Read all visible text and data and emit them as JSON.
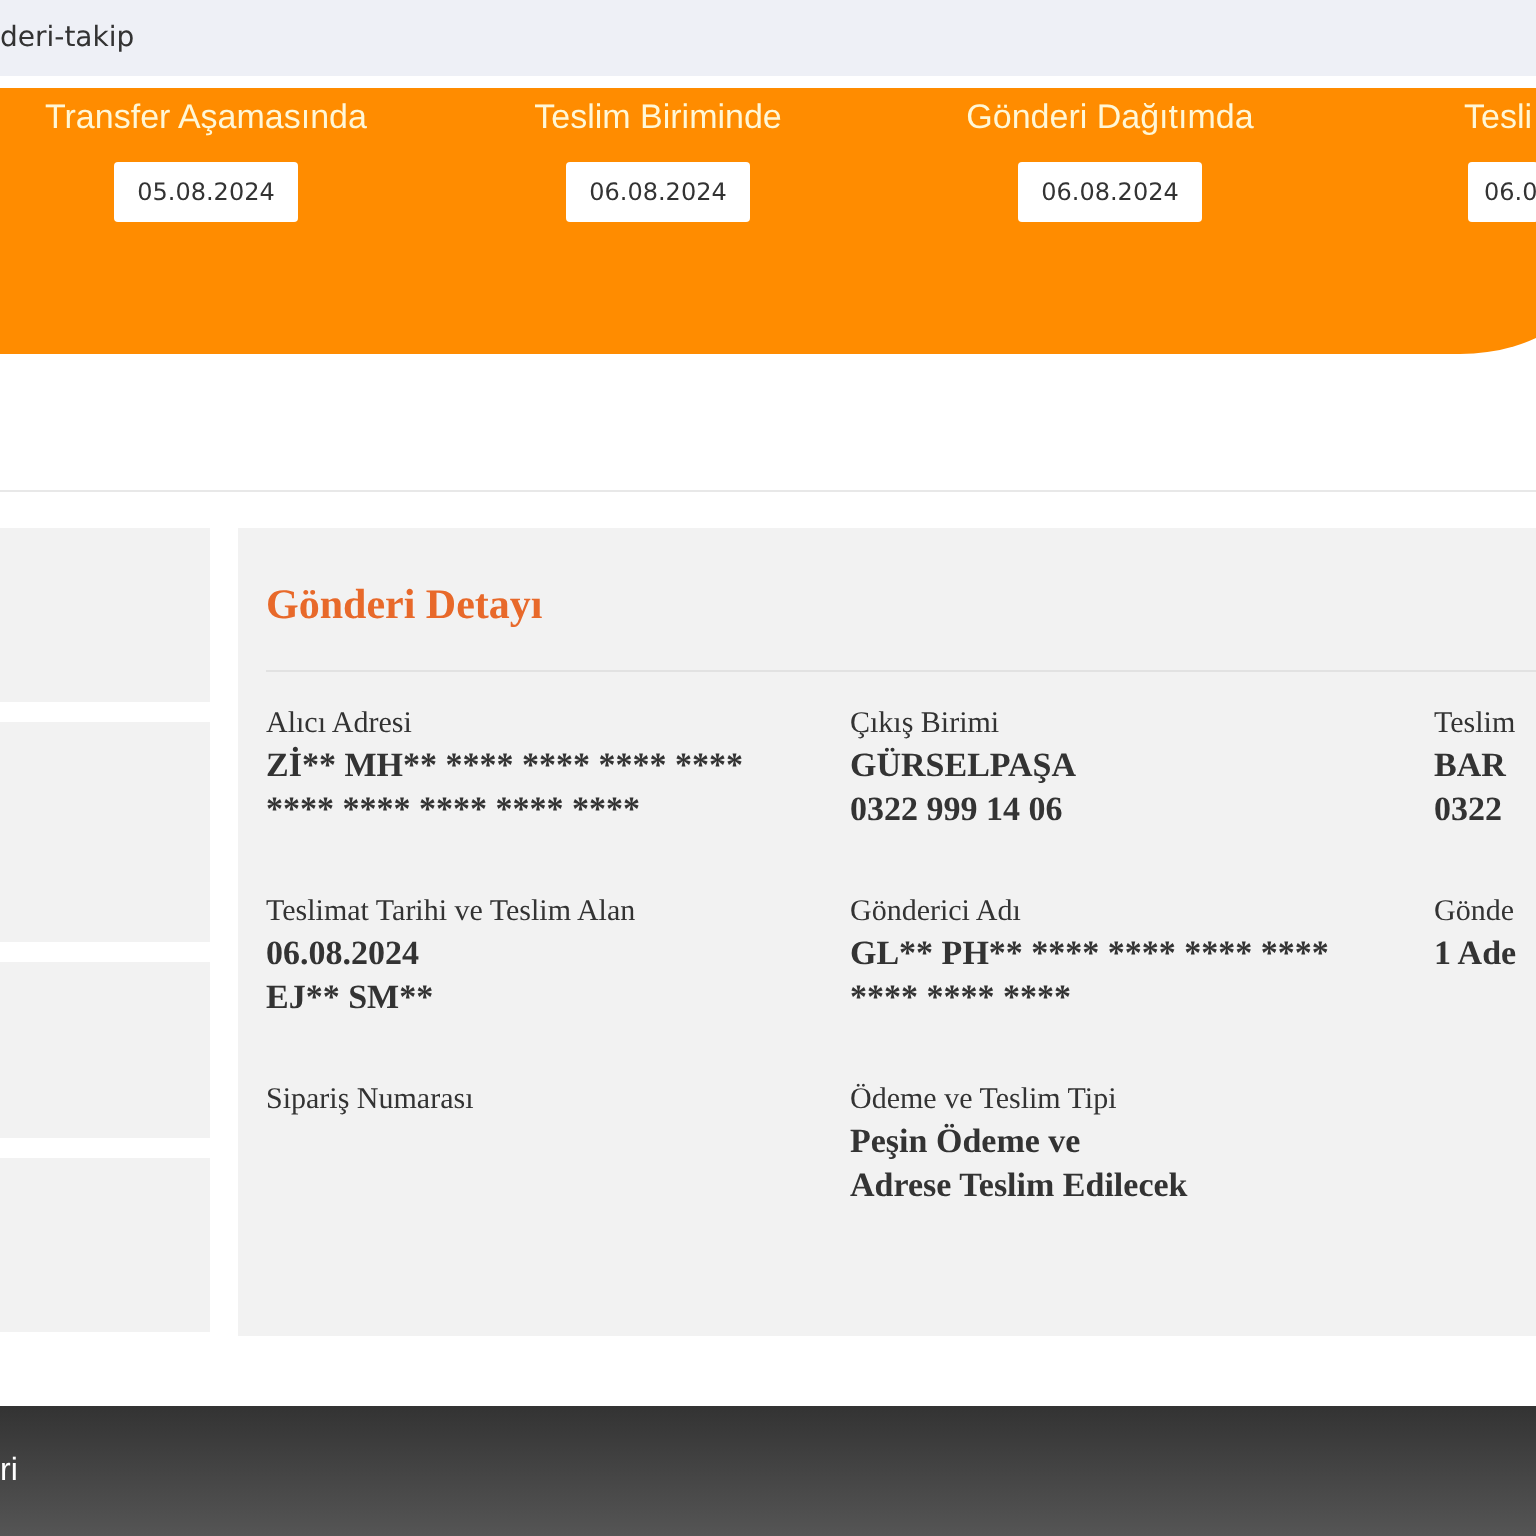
{
  "address_bar": {
    "text": "deri-takip"
  },
  "steps": [
    {
      "label": "Transfer Aşamasında",
      "date": "05.08.2024"
    },
    {
      "label": "Teslim Biriminde",
      "date": "06.08.2024"
    },
    {
      "label": "Gönderi Dağıtımda",
      "date": "06.08.2024"
    },
    {
      "label": "Tesli",
      "date": "06.0"
    }
  ],
  "detail": {
    "title": "Gönderi Detayı",
    "fields": [
      {
        "label": "Alıcı Adresi",
        "lines": [
          "Zİ** MH** **** **** **** ****",
          "**** **** **** **** ****"
        ]
      },
      {
        "label": "Çıkış Birimi",
        "lines": [
          "GÜRSELPAŞA",
          "0322 999 14 06"
        ]
      },
      {
        "label": "Teslim",
        "lines": [
          "BAR",
          "0322"
        ]
      },
      {
        "label": "Teslimat Tarihi ve Teslim Alan",
        "lines": [
          "06.08.2024",
          "EJ** SM**"
        ]
      },
      {
        "label": "Gönderici Adı",
        "lines": [
          "GL** PH** **** **** **** ****",
          "**** **** ****"
        ]
      },
      {
        "label": "Gönde",
        "lines": [
          "1 Ade"
        ]
      },
      {
        "label": "Sipariş Numarası"
      },
      {
        "label": "Ödeme ve Teslim Tipi",
        "lines": [
          "Peşin Ödeme ve",
          "Adrese Teslim Edilecek"
        ]
      }
    ]
  },
  "footer": {
    "text": "ri"
  }
}
